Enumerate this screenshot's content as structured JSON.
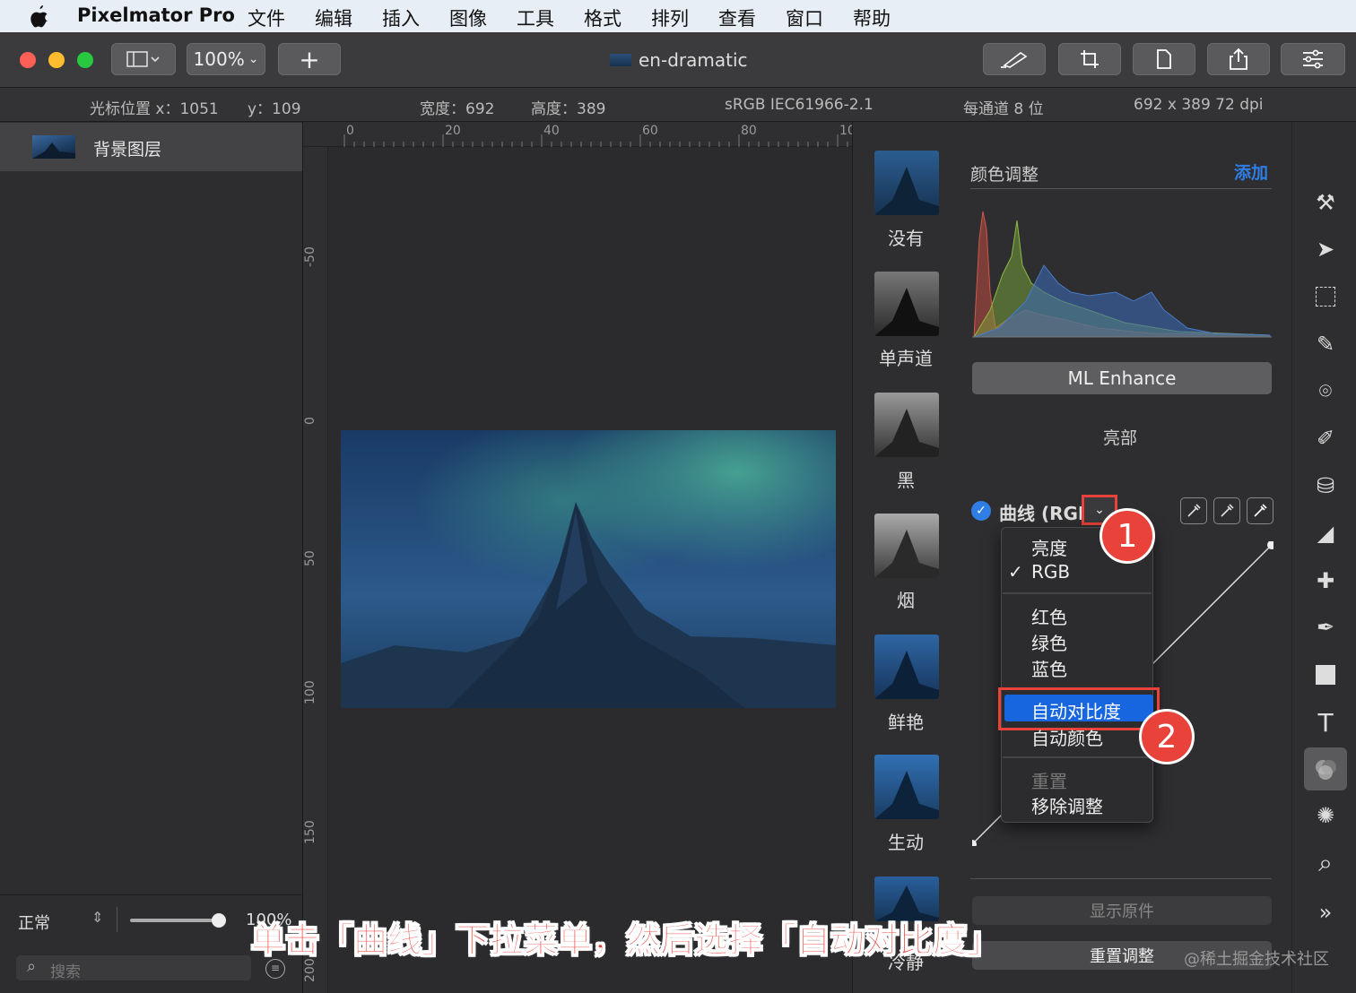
{
  "menubar": {
    "app_name": "Pixelmator Pro",
    "items": [
      "文件",
      "编辑",
      "插入",
      "图像",
      "工具",
      "格式",
      "排列",
      "查看",
      "窗口",
      "帮助"
    ]
  },
  "toolbar": {
    "zoom": "100%",
    "add": "+",
    "title": "en-dramatic"
  },
  "infobar": {
    "cursor_x": "光标位置 x：1051",
    "cursor_y": "y：109",
    "width": "宽度：692",
    "height": "高度：389",
    "profile": "sRGB IEC61966-2.1",
    "depth": "每通道 8 位",
    "size": "692 x 389 72 dpi"
  },
  "layers": {
    "name": "背景图层",
    "blend_mode": "正常",
    "opacity": "100%",
    "search_placeholder": "搜索"
  },
  "ruler": {
    "h": [
      "0",
      "20",
      "40",
      "60",
      "80",
      "10"
    ],
    "v": [
      "-50",
      "0",
      "50",
      "100",
      "150",
      "200"
    ]
  },
  "presets": [
    "没有",
    "单声道",
    "黑",
    "烟",
    "鲜艳",
    "生动",
    "冷静"
  ],
  "adjustments": {
    "header": "颜色调整",
    "add": "添加",
    "ml_enhance": "ML Enhance",
    "highlights": "亮部",
    "curves_title": "曲线 (RGB",
    "show_original": "显示原件",
    "reset": "重置调整"
  },
  "dropdown": {
    "items": [
      "亮度",
      "RGB",
      "红色",
      "绿色",
      "蓝色",
      "自动对比度",
      "自动颜色",
      "重置",
      "移除调整"
    ],
    "checked": "RGB",
    "highlighted": "自动对比度"
  },
  "annotation": {
    "badge1": "1",
    "badge2": "2",
    "caption": "单击「曲线」下拉菜单，然后选择「自动对比度」",
    "watermark": "@稀土掘金技术社区"
  },
  "colors": {
    "accent": "#2f7ee6",
    "annotation_red": "#e8423a"
  }
}
